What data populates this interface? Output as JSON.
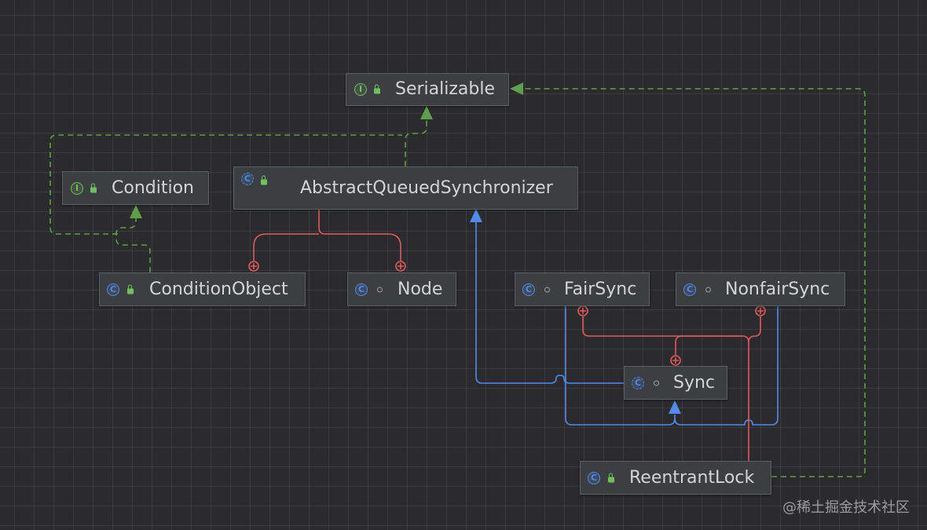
{
  "diagram": {
    "nodes": {
      "serializable": {
        "name": "Serializable",
        "kind": "interface",
        "icon_letter": "I",
        "visibility": "public"
      },
      "condition": {
        "name": "Condition",
        "kind": "interface",
        "icon_letter": "I",
        "visibility": "public"
      },
      "aqs": {
        "name": "AbstractQueuedSynchronizer",
        "kind": "abstract-class",
        "icon_letter": "C",
        "visibility": "public"
      },
      "condition_object": {
        "name": "ConditionObject",
        "kind": "class",
        "icon_letter": "C",
        "visibility": "public"
      },
      "node": {
        "name": "Node",
        "kind": "class",
        "icon_letter": "C",
        "visibility": "package-private"
      },
      "fair_sync": {
        "name": "FairSync",
        "kind": "class",
        "icon_letter": "C",
        "visibility": "package-private"
      },
      "nonfair_sync": {
        "name": "NonfairSync",
        "kind": "class",
        "icon_letter": "C",
        "visibility": "package-private"
      },
      "sync": {
        "name": "Sync",
        "kind": "abstract-class",
        "icon_letter": "C",
        "visibility": "package-private"
      },
      "reentrant_lock": {
        "name": "ReentrantLock",
        "kind": "class",
        "icon_letter": "C",
        "visibility": "public"
      }
    },
    "edges": [
      {
        "from": "aqs",
        "to": "serializable",
        "type": "implements"
      },
      {
        "from": "condition_object",
        "to": "serializable",
        "type": "implements"
      },
      {
        "from": "condition_object",
        "to": "condition",
        "type": "implements"
      },
      {
        "from": "reentrant_lock",
        "to": "serializable",
        "type": "implements"
      },
      {
        "from": "sync",
        "to": "aqs",
        "type": "extends"
      },
      {
        "from": "fair_sync",
        "to": "sync",
        "type": "extends"
      },
      {
        "from": "nonfair_sync",
        "to": "sync",
        "type": "extends"
      },
      {
        "from": "aqs",
        "to": "condition_object",
        "type": "inner-class"
      },
      {
        "from": "aqs",
        "to": "node",
        "type": "inner-class"
      },
      {
        "from": "reentrant_lock",
        "to": "fair_sync",
        "type": "inner-class"
      },
      {
        "from": "reentrant_lock",
        "to": "nonfair_sync",
        "type": "inner-class"
      },
      {
        "from": "reentrant_lock",
        "to": "sync",
        "type": "inner-class"
      }
    ],
    "colors": {
      "background": "#2b2b2d",
      "node_fill": "#3c3f41",
      "implements": "#5f9f4a",
      "extends": "#4f8bf0",
      "inner_class": "#e05a5a"
    }
  },
  "watermark": "@稀土掘金技术社区"
}
